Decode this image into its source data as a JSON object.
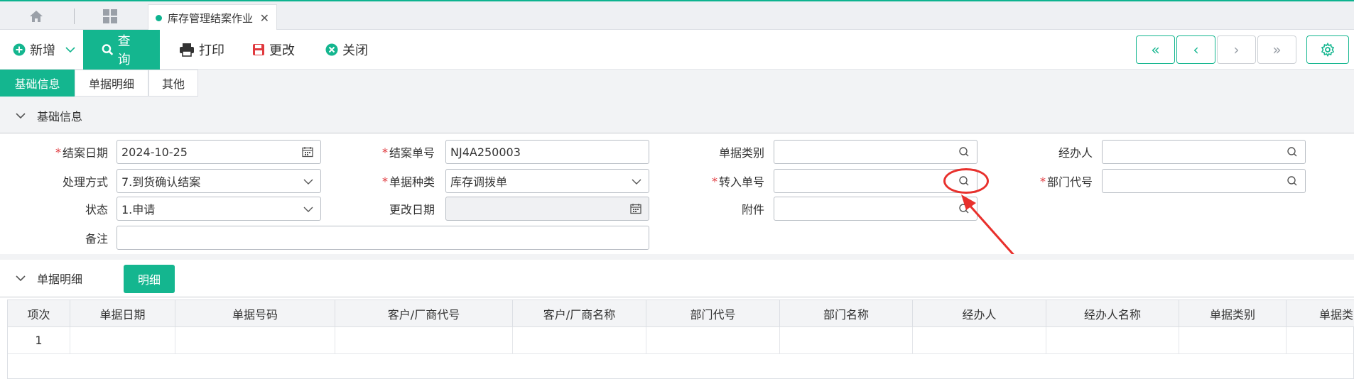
{
  "top_tabs": {
    "active_tab": "库存管理结案作业",
    "close": "✕"
  },
  "toolbar": {
    "add": "新增",
    "query": "查询",
    "print": "打印",
    "modify": "更改",
    "close": "关闭",
    "nav": {
      "first": "«",
      "prev": "‹",
      "next": "›",
      "last": "»"
    }
  },
  "sub_tabs": [
    "基础信息",
    "单据明细",
    "其他"
  ],
  "basic_section": {
    "title": "基础信息"
  },
  "form": {
    "close_date": {
      "label": "结案日期",
      "value": "2024-10-25",
      "required": true
    },
    "close_no": {
      "label": "结案单号",
      "value": "NJ4A250003",
      "required": true
    },
    "doc_category": {
      "label": "单据类别",
      "value": ""
    },
    "handler": {
      "label": "经办人",
      "value": ""
    },
    "process_method": {
      "label": "处理方式",
      "value": "7.到货确认结案"
    },
    "doc_type": {
      "label": "单据种类",
      "value": "库存调拨单",
      "required": true
    },
    "transfer_no": {
      "label": "转入单号",
      "value": "",
      "required": true
    },
    "dept_code": {
      "label": "部门代号",
      "value": "",
      "required": true
    },
    "status": {
      "label": "状态",
      "value": "1.申请"
    },
    "modify_date": {
      "label": "更改日期",
      "value": ""
    },
    "attachment": {
      "label": "附件",
      "value": ""
    },
    "remark": {
      "label": "备注",
      "value": ""
    }
  },
  "detail_section": {
    "title": "单据明细",
    "detail_button": "明细"
  },
  "grid": {
    "columns": [
      "项次",
      "单据日期",
      "单据号码",
      "客户/厂商代号",
      "客户/厂商名称",
      "部门代号",
      "部门名称",
      "经办人",
      "经办人名称",
      "单据类别",
      "单据类"
    ],
    "rows": [
      [
        "1",
        "",
        "",
        "",
        "",
        "",
        "",
        "",
        "",
        "",
        ""
      ]
    ]
  },
  "colors": {
    "accent": "#14b68f",
    "required": "#e0393e",
    "annotation": "#e8302c"
  }
}
